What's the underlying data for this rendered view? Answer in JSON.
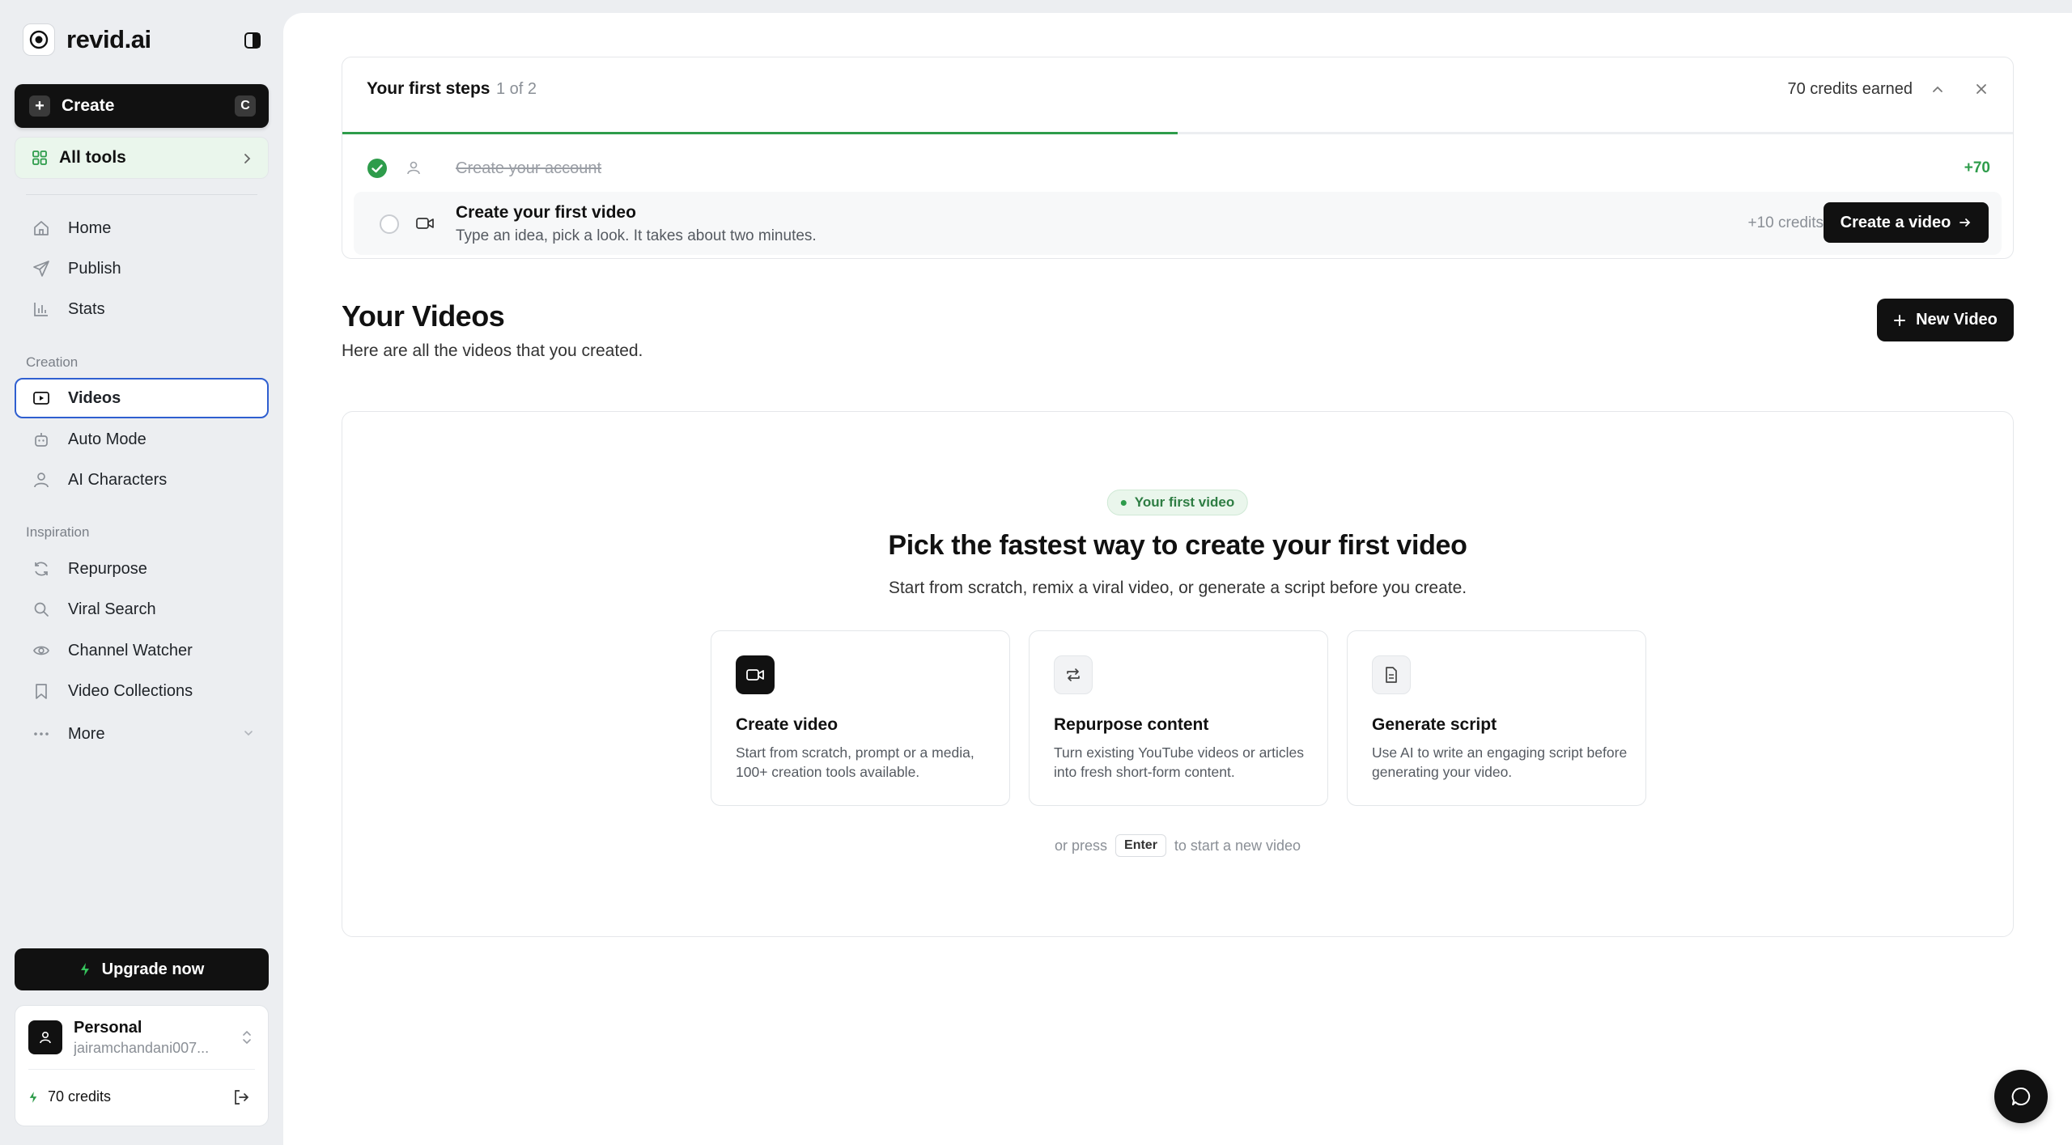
{
  "brand": {
    "name": "revid.ai"
  },
  "sidebar": {
    "create": {
      "label": "Create",
      "shortcut": "C"
    },
    "all_tools": {
      "label": "All tools"
    },
    "main_nav": [
      {
        "label": "Home",
        "icon": "home-icon"
      },
      {
        "label": "Publish",
        "icon": "send-icon"
      },
      {
        "label": "Stats",
        "icon": "bar-chart-icon"
      }
    ],
    "creation_section": {
      "label": "Creation"
    },
    "creation_nav": [
      {
        "label": "Videos",
        "icon": "video-icon",
        "active": true
      },
      {
        "label": "Auto Mode",
        "icon": "robot-icon"
      },
      {
        "label": "AI Characters",
        "icon": "user-icon"
      }
    ],
    "inspiration_section": {
      "label": "Inspiration"
    },
    "inspiration_nav": [
      {
        "label": "Repurpose",
        "icon": "refresh-icon"
      },
      {
        "label": "Viral Search",
        "icon": "search-icon"
      },
      {
        "label": "Channel Watcher",
        "icon": "eye-icon"
      },
      {
        "label": "Video Collections",
        "icon": "bookmark-icon"
      },
      {
        "label": "More",
        "icon": "more-dots-icon"
      }
    ],
    "upgrade": {
      "label": "Upgrade now"
    },
    "account": {
      "name": "Personal",
      "email": "jairamchandani007...",
      "credits": "70 credits"
    }
  },
  "first_steps": {
    "title": "Your first steps",
    "progress_text": "1 of 2",
    "progress_fraction": 0.5,
    "credits_earned": "70 credits earned",
    "steps": [
      {
        "label": "Create your account",
        "credits": "+70",
        "done": true
      },
      {
        "label": "Create your first video",
        "description": "Type an idea, pick a look. It takes about two minutes.",
        "credits": "+10 credits",
        "button": "Create a video",
        "done": false
      }
    ]
  },
  "videos": {
    "title": "Your Videos",
    "subtitle": "Here are all the videos that you created.",
    "new_button": "New Video"
  },
  "empty_state": {
    "pill": "Your first video",
    "headline": "Pick the fastest way to create your first video",
    "subtitle": "Start from scratch, remix a viral video, or generate a script before you create.",
    "options": [
      {
        "title": "Create video",
        "description": "Start from scratch, prompt or a media, 100+ creation tools available.",
        "icon": "video-camera-icon"
      },
      {
        "title": "Repurpose content",
        "description": "Turn existing YouTube videos or articles into fresh short-form content.",
        "icon": "repeat-icon"
      },
      {
        "title": "Generate script",
        "description": "Use AI to write an engaging script before generating your video.",
        "icon": "document-icon"
      }
    ],
    "press_before": "or press",
    "press_key": "Enter",
    "press_after": "to start a new video"
  },
  "colors": {
    "accent_green": "#2e9c4b",
    "active_border": "#2f5fd0",
    "dark": "#111111"
  }
}
